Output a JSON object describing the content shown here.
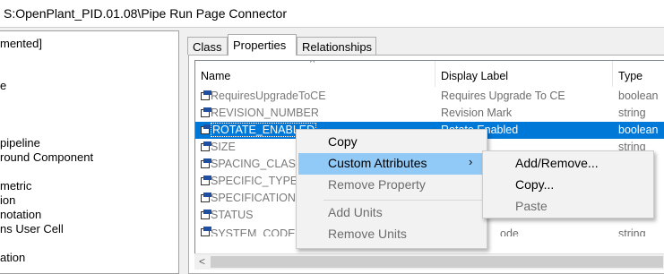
{
  "window": {
    "title": "S:OpenPlant_PID.01.08\\Pipe Run Page Connector"
  },
  "tree": {
    "items": [
      "mented]",
      "e",
      "pipeline",
      "round Component",
      "metric",
      "ion",
      "notation",
      "ns User Cell",
      "ation"
    ]
  },
  "tabs": [
    "Class",
    "Properties",
    "Relationships"
  ],
  "grid": {
    "columns": [
      "Name",
      "Display Label",
      "Type"
    ],
    "rows": [
      {
        "name": "RequiresUpgradeToCE",
        "label": "Requires Upgrade To CE",
        "type": "boolean"
      },
      {
        "name": "REVISION_NUMBER",
        "label": "Revision Mark",
        "type": "string"
      },
      {
        "name": "ROTATE_ENABLED",
        "label": "Rotate Enabled",
        "type": "boolean",
        "selected": true
      },
      {
        "name": "SIZE",
        "label": "",
        "type": "string"
      },
      {
        "name": "SPACING_CLASS",
        "label": "",
        "type": ""
      },
      {
        "name": "SPECIFIC_TYPE",
        "label": "",
        "type": ""
      },
      {
        "name": "SPECIFICATION",
        "label": "",
        "type": ""
      },
      {
        "name": "STATUS",
        "label": "",
        "type": ""
      },
      {
        "name": "SYSTEM_CODE",
        "label": "ode",
        "type": "string"
      }
    ]
  },
  "context_menu": {
    "items": [
      {
        "label": "Copy",
        "enabled": true
      },
      {
        "label": "Custom Attributes",
        "enabled": true,
        "submenu": true,
        "highlighted": true
      },
      {
        "label": "Remove Property",
        "enabled": false
      },
      {
        "label": "Add Units",
        "enabled": false
      },
      {
        "label": "Remove Units",
        "enabled": false
      }
    ],
    "submenu_arrow": "›"
  },
  "submenu": {
    "items": [
      {
        "label": "Add/Remove...",
        "enabled": true
      },
      {
        "label": "Copy...",
        "enabled": true
      },
      {
        "label": "Paste",
        "enabled": false
      }
    ]
  },
  "colors": {
    "selection": "#0078d7",
    "menu_highlight": "#91c9f7"
  },
  "icons": {
    "property": "property-icon",
    "sort": "sort-up-icon",
    "scroll_left": "scroll-left-arrow-icon"
  }
}
